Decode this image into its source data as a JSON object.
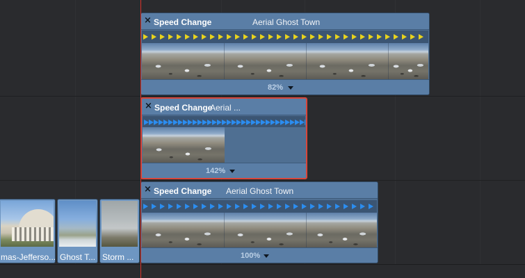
{
  "timeline": {
    "clips": [
      {
        "effect": "Speed Change",
        "title": "Aerial Ghost Town",
        "speed": "82%",
        "arrow_color": "yellow",
        "selected": false
      },
      {
        "effect": "Speed Change",
        "title": "Aerial ...",
        "speed": "142%",
        "arrow_color": "blue",
        "selected": true
      },
      {
        "effect": "Speed Change",
        "title": "Aerial Ghost Town",
        "speed": "100%",
        "arrow_color": "blue",
        "selected": false
      }
    ],
    "primary_clips": [
      {
        "label": "mas-Jefferso..."
      },
      {
        "label": "Ghost T..."
      },
      {
        "label": "Storm ..."
      }
    ]
  },
  "colors": {
    "background": "#2a2b2e",
    "clip_fill": "#4f6f92",
    "clip_header": "#5a7ea6",
    "selection_border": "#d9463a",
    "playhead": "#d8332b",
    "arrow_yellow": "#e8d31d",
    "arrow_blue": "#2b8df0"
  },
  "icons": {
    "close": "close-icon",
    "dropdown": "chevron-down-icon",
    "speed_arrow": "play-arrow-icon"
  }
}
